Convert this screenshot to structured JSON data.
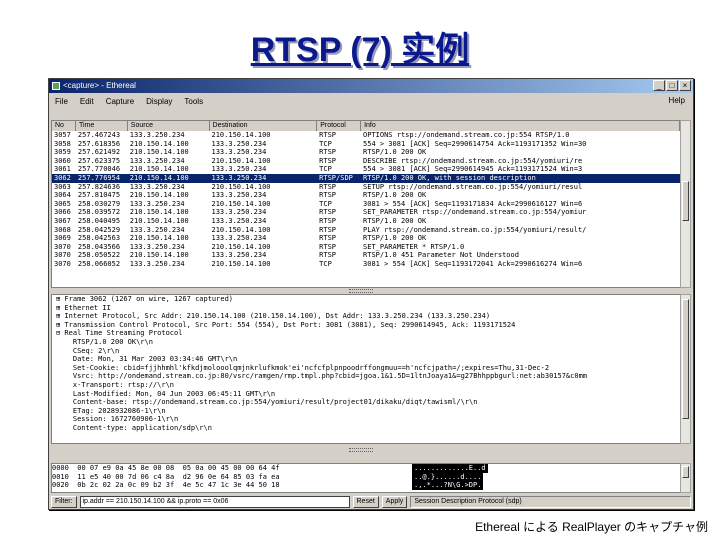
{
  "slide": {
    "title": "RTSP (7) 实例",
    "caption": "Ethereal による RealPlayer のキャプチャ例"
  },
  "window": {
    "title": "<capture> - Ethereal",
    "controls": [
      "_",
      "□",
      "×"
    ]
  },
  "menu": {
    "items": [
      "File",
      "Edit",
      "Capture",
      "Display",
      "Tools"
    ],
    "help": "Help"
  },
  "packet_list": {
    "headers": [
      "No",
      "Time",
      "Source",
      "Destination",
      "Protocol",
      "Info"
    ],
    "rows": [
      {
        "no": "3057",
        "time": "257.467243",
        "src": "133.3.250.234",
        "dst": "210.150.14.100",
        "proto": "RTSP",
        "info": "OPTIONS rtsp://ondemand.stream.co.jp:554 RTSP/1.0"
      },
      {
        "no": "3058",
        "time": "257.618356",
        "src": "210.150.14.100",
        "dst": "133.3.250.234",
        "proto": "TCP",
        "info": "554 > 3081 [ACK] Seq=2990614754 Ack=1193171352 Win=30"
      },
      {
        "no": "3059",
        "time": "257.621492",
        "src": "210.150.14.100",
        "dst": "133.3.250.234",
        "proto": "RTSP",
        "info": "RTSP/1.0 200 OK"
      },
      {
        "no": "3060",
        "time": "257.623375",
        "src": "133.3.250.234",
        "dst": "210.150.14.100",
        "proto": "RTSP",
        "info": "DESCRIBE rtsp://ondemand.stream.co.jp:554/yomiuri/re"
      },
      {
        "no": "3061",
        "time": "257.770046",
        "src": "210.150.14.100",
        "dst": "133.3.250.234",
        "proto": "TCP",
        "info": "554 > 3081 [ACK] Seq=2990614945 Ack=1193171524 Win=3"
      },
      {
        "no": "3062",
        "time": "257.776954",
        "src": "210.150.14.100",
        "dst": "133.3.250.234",
        "proto": "RTSP/SDP",
        "info": "RTSP/1.0 200 OK, with session description"
      },
      {
        "no": "3063",
        "time": "257.824636",
        "src": "133.3.250.234",
        "dst": "210.150.14.100",
        "proto": "RTSP",
        "info": "SETUP rtsp://ondemand.stream.co.jp:554/yomiuri/resul"
      },
      {
        "no": "3064",
        "time": "257.810475",
        "src": "210.150.14.100",
        "dst": "133.3.250.234",
        "proto": "RTSP",
        "info": "RTSP/1.0 200 OK"
      },
      {
        "no": "3065",
        "time": "258.030279",
        "src": "133.3.250.234",
        "dst": "210.150.14.100",
        "proto": "TCP",
        "info": "3081 > 554 [ACK] Seq=1193171834 Ack=2990616127 Win=6"
      },
      {
        "no": "3066",
        "time": "258.039572",
        "src": "210.150.14.100",
        "dst": "133.3.250.234",
        "proto": "RTSP",
        "info": "SET_PARAMETER rtsp://ondemand.stream.co.jp:554/yomiur"
      },
      {
        "no": "3067",
        "time": "258.040495",
        "src": "210.150.14.100",
        "dst": "133.3.250.234",
        "proto": "RTSP",
        "info": "RTSP/1.0 200 OK"
      },
      {
        "no": "3068",
        "time": "258.042529",
        "src": "133.3.250.234",
        "dst": "210.150.14.100",
        "proto": "RTSP",
        "info": "PLAY rtsp://ondemand.stream.co.jp:554/yomiuri/result/"
      },
      {
        "no": "3069",
        "time": "258.042563",
        "src": "210.150.14.100",
        "dst": "133.3.250.234",
        "proto": "RTSP",
        "info": "RTSP/1.0 200 OK"
      },
      {
        "no": "3070",
        "time": "258.043566",
        "src": "133.3.250.234",
        "dst": "210.150.14.100",
        "proto": "RTSP",
        "info": "SET_PARAMETER * RTSP/1.0"
      },
      {
        "no": "3070",
        "time": "258.050522",
        "src": "210.150.14.100",
        "dst": "133.3.250.234",
        "proto": "RTSP",
        "info": "RTSP/1.0 451 Parameter Not Understood"
      },
      {
        "no": "3070",
        "time": "258.066052",
        "src": "133.3.250.234",
        "dst": "210.150.14.100",
        "proto": "TCP",
        "info": "3081 > 554 [ACK] Seq=1193172041 Ack=2990616274 Win=6"
      }
    ],
    "selected_index": 5
  },
  "packet_detail": {
    "lines": [
      "⊞ Frame 3062 (1267 on wire, 1267 captured)",
      "⊞ Ethernet II",
      "⊞ Internet Protocol, Src Addr: 210.150.14.100 (210.150.14.100), Dst Addr: 133.3.250.234 (133.3.250.234)",
      "⊞ Transmission Control Protocol, Src Port: 554 (554), Dst Port: 3081 (3081), Seq: 2990614945, Ack: 1193171524",
      "⊟ Real Time Streaming Protocol",
      "    RTSP/1.0 200 OK\\r\\n",
      "    CSeq: 2\\r\\n",
      "    Date: Mon, 31 Mar 2003 03:34:46 GMT\\r\\n",
      "    Set-Cookie: cbid=fjjhhmhl'kfkdjmolooolqmjnkrlufkmok'ei'ncfcfplpnpoodrffongmuu==h'ncfcjpath=/;expires=Thu,31-Dec-2",
      "    Vsrc: http://ondemand.stream.co.jp:80/vsrc/ramgen/rmp.tmpl.php?cbid=jgoa.1&1.5D=1ltnJoaya1&=g27Bhhppbgurl:net:ab30157&c0mm",
      "    x-Transport: rtsp://\\r\\n",
      "    Last-Modified: Mon, 04 Jun 2003 06:45:11 GMT\\r\\n",
      "    Content-base: rtsp://ondemand.stream.co.jp:554/yomiuri/result/project01/dikaku/diqt/tawisml/\\r\\n",
      "    ETag: 2028932086-1\\r\\n",
      "    Session: 1672760906-1\\r\\n",
      "    Content-type: application/sdp\\r\\n"
    ]
  },
  "hex_dump": {
    "lines": [
      {
        "hex": "0000  00 07 e9 0a 45 8e 00 08  05 0a 00 45 00 00 64 4f",
        "ascii": ".............E..d"
      },
      {
        "hex": "0010  11 e5 40 00 7d 06 c4 8a  d2 96 0e 64 85 03 fa ea",
        "ascii": "..@.}......d...."
      },
      {
        "hex": "0020  0b 2c 02 2a 0c 09 b2 3f  4e 5c 47 1c 3e 44 50 18",
        "ascii": ".,.*...?N\\G.>DP."
      }
    ]
  },
  "filter": {
    "label": "Filter:",
    "value": "ip.addr == 210.150.14.100 && ip.proto == 0x06",
    "reset_label": "Reset",
    "apply_label": "Apply",
    "status": "Session Description Protocol (sdp)"
  }
}
